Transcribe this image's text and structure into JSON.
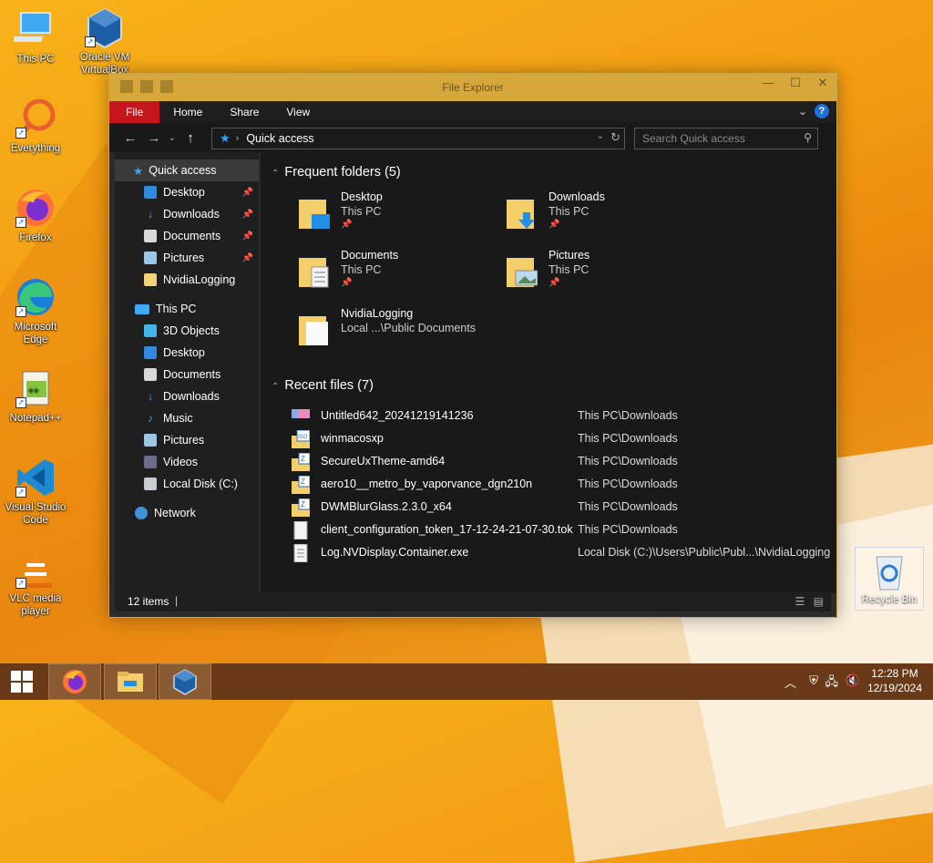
{
  "desktop": {
    "icons": [
      {
        "label": "This PC"
      },
      {
        "label": "Oracle VM VirtualBox"
      },
      {
        "label": "Everything"
      },
      {
        "label": "Firefox"
      },
      {
        "label": "Microsoft Edge"
      },
      {
        "label": "Notepad++"
      },
      {
        "label": "Visual Studio Code"
      },
      {
        "label": "VLC media player"
      }
    ],
    "recycle_bin": "Recycle Bin"
  },
  "window": {
    "title": "File Explorer",
    "ribbon_tabs": [
      "File",
      "Home",
      "Share",
      "View"
    ],
    "address": "Quick access",
    "search_placeholder": "Search Quick access",
    "nav": {
      "quick_access": "Quick access",
      "pinned": [
        "Desktop",
        "Downloads",
        "Documents",
        "Pictures",
        "NvidiaLogging"
      ],
      "this_pc": "This PC",
      "this_pc_items": [
        "3D Objects",
        "Desktop",
        "Documents",
        "Downloads",
        "Music",
        "Pictures",
        "Videos",
        "Local Disk (C:)"
      ],
      "network": "Network"
    },
    "frequent_title": "Frequent folders (5)",
    "frequent": [
      {
        "name": "Desktop",
        "loc": "This PC"
      },
      {
        "name": "Downloads",
        "loc": "This PC"
      },
      {
        "name": "Documents",
        "loc": "This PC"
      },
      {
        "name": "Pictures",
        "loc": "This PC"
      },
      {
        "name": "NvidiaLogging",
        "loc": "Local ...\\Public Documents"
      }
    ],
    "recent_title": "Recent files (7)",
    "recent": [
      {
        "name": "Untitled642_20241219141236",
        "path": "This PC\\Downloads"
      },
      {
        "name": "winmacosxp",
        "path": "This PC\\Downloads"
      },
      {
        "name": "SecureUxTheme-amd64",
        "path": "This PC\\Downloads"
      },
      {
        "name": "aero10__metro_by_vaporvance_dgn210n",
        "path": "This PC\\Downloads"
      },
      {
        "name": "DWMBlurGlass.2.3.0_x64",
        "path": "This PC\\Downloads"
      },
      {
        "name": "client_configuration_token_17-12-24-21-07-30.tok",
        "path": "This PC\\Downloads"
      },
      {
        "name": "Log.NVDisplay.Container.exe",
        "path": "Local Disk (C:)\\Users\\Public\\Publ...\\NvidiaLogging"
      }
    ],
    "status": "12 items"
  },
  "taskbar": {
    "time": "12:28 PM",
    "date": "12/19/2024"
  },
  "colors": {
    "file_tab": "#c4161c",
    "window_border": "#d6a73b",
    "taskbar": "#6a3a18",
    "accent_blue": "#3aa0ff"
  }
}
